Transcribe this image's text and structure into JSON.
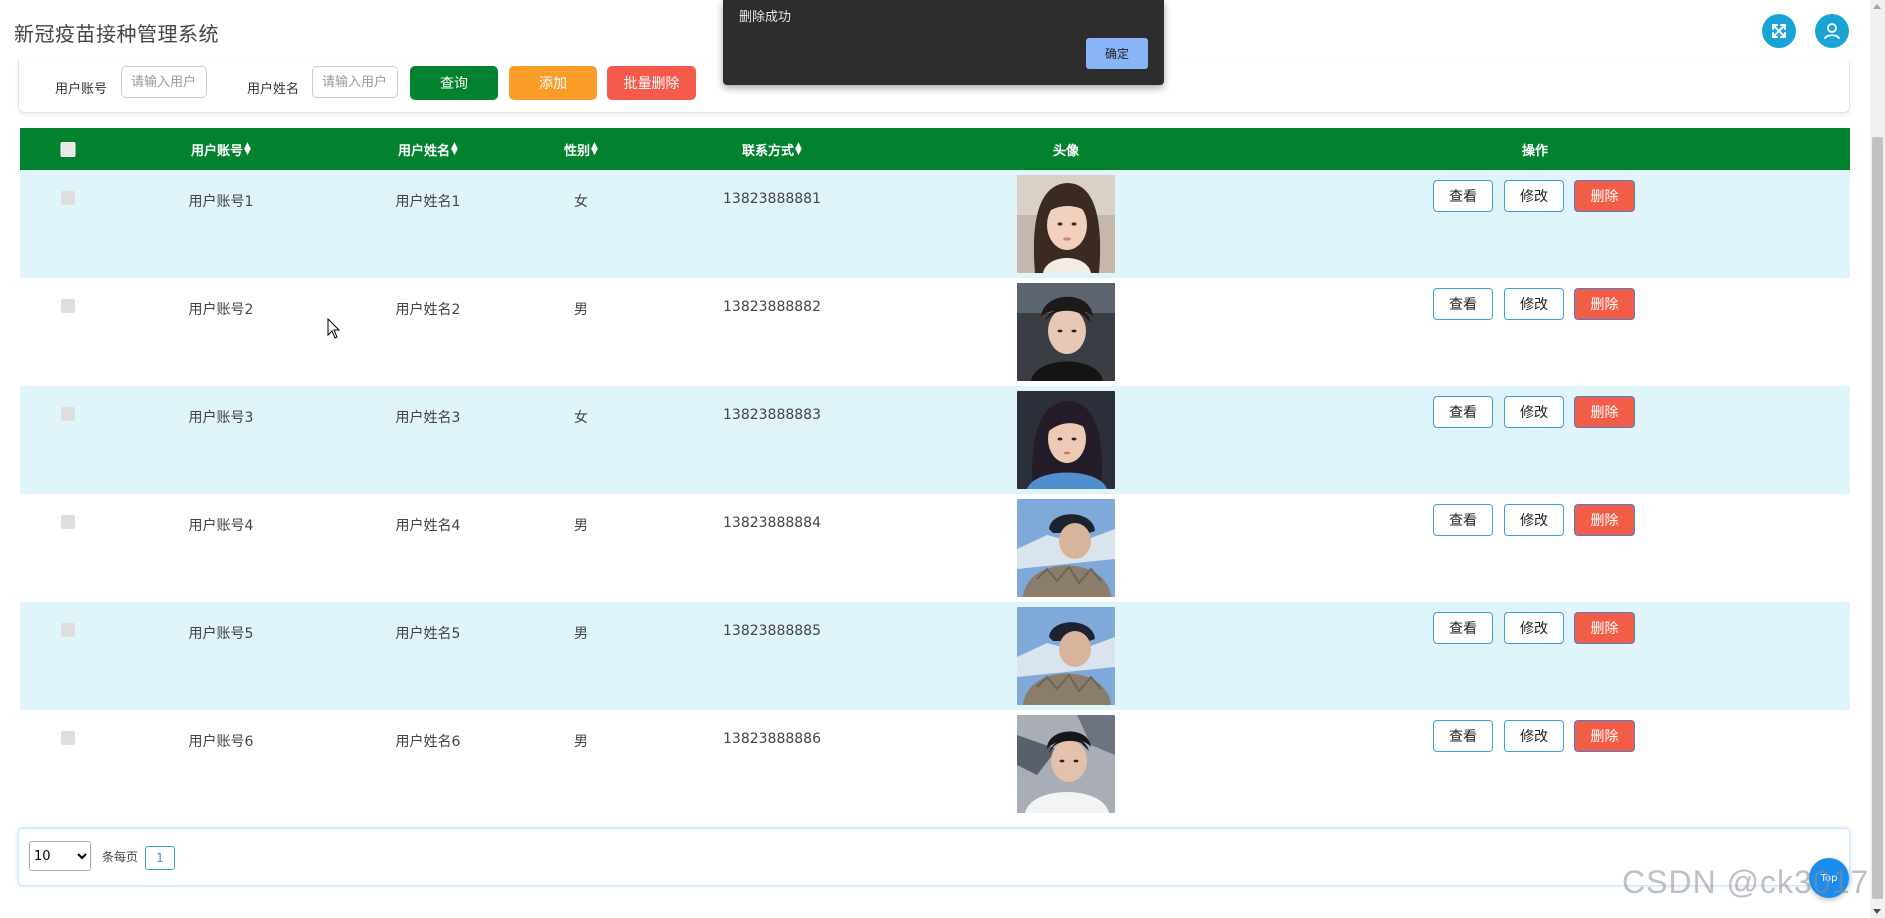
{
  "header": {
    "title": "新冠疫苗接种管理系统",
    "fullscreen_icon": "fullscreen-icon",
    "user_icon": "user-icon",
    "accent_color": "#1aa3d6"
  },
  "search": {
    "account_label": "用户账号",
    "account_placeholder": "请输入用户",
    "name_label": "用户姓名",
    "name_placeholder": "请输入用户",
    "query_label": "查询",
    "add_label": "添加",
    "batch_delete_label": "批量删除",
    "colors": {
      "query": "#02822e",
      "add": "#f99c28",
      "batch_delete": "#f55a4a"
    }
  },
  "toast": {
    "message": "删除成功",
    "ok_label": "确定"
  },
  "table": {
    "header_color": "#02822e",
    "columns": [
      "用户账号",
      "用户姓名",
      "性别",
      "联系方式",
      "头像",
      "操作"
    ],
    "sort_icon": "sort-arrows-icon",
    "rows": [
      {
        "account": "用户账号1",
        "name": "用户姓名1",
        "gender": "女",
        "phone": "13823888881",
        "avatar": "avatar-female-1"
      },
      {
        "account": "用户账号2",
        "name": "用户姓名2",
        "gender": "男",
        "phone": "13823888882",
        "avatar": "avatar-male-2"
      },
      {
        "account": "用户账号3",
        "name": "用户姓名3",
        "gender": "女",
        "phone": "13823888883",
        "avatar": "avatar-female-3"
      },
      {
        "account": "用户账号4",
        "name": "用户姓名4",
        "gender": "男",
        "phone": "13823888884",
        "avatar": "avatar-male-4"
      },
      {
        "account": "用户账号5",
        "name": "用户姓名5",
        "gender": "男",
        "phone": "13823888885",
        "avatar": "avatar-male-5"
      },
      {
        "account": "用户账号6",
        "name": "用户姓名6",
        "gender": "男",
        "phone": "13823888886",
        "avatar": "avatar-male-6"
      }
    ],
    "actions": {
      "view_label": "查看",
      "edit_label": "修改",
      "delete_label": "删除"
    }
  },
  "pagination": {
    "page_size": "10",
    "page_size_options": [
      "10"
    ],
    "per_page_label": "条每页",
    "current_page": "1"
  },
  "floating": {
    "top_label": "Top"
  },
  "watermark": "CSDN @ck3017"
}
